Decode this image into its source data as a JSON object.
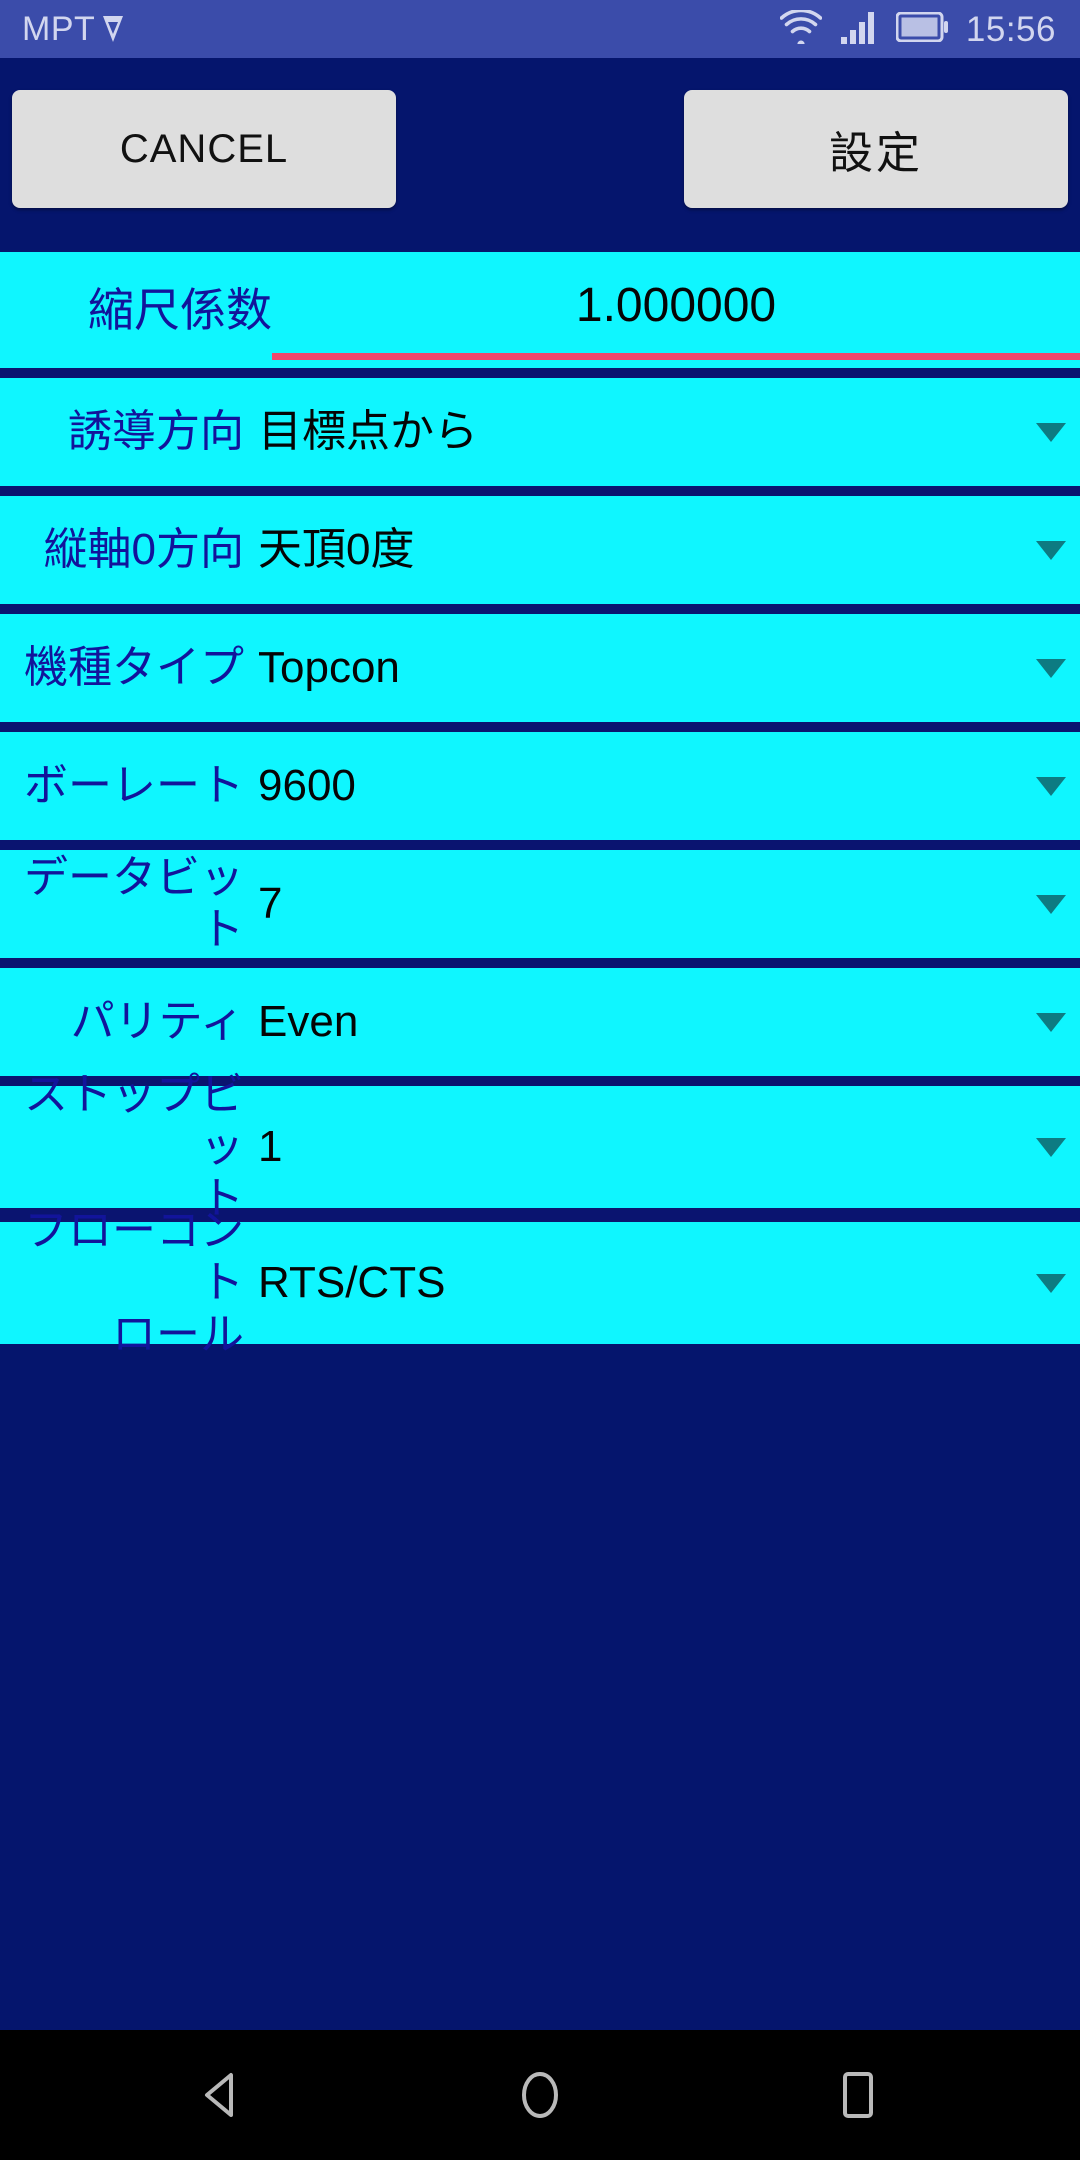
{
  "status_bar": {
    "carrier": "MPT",
    "carrier_logo_icon": "play-badge-icon",
    "wifi_icon": "wifi-icon",
    "signal_icon": "cellular-signal-icon",
    "battery_icon": "battery-full-icon",
    "time": "15:56",
    "background_color": "#3b4caa",
    "foreground_color": "#d2d6ef"
  },
  "toolbar": {
    "cancel_label": "CANCEL",
    "confirm_label": "設定",
    "button_background": "#dedede",
    "button_text_color": "#111111"
  },
  "theme": {
    "app_background": "#05156d",
    "row_background": "#0ff6ff",
    "row_divider": "#0a1470",
    "label_color": "#12149b",
    "value_color": "#050505",
    "underline_color": "#f0486b",
    "caret_color": "#0d7b82"
  },
  "settings": {
    "scale_factor": {
      "label": "縮尺係数",
      "value": "1.000000",
      "type": "text-field"
    },
    "rows": [
      {
        "label": "誘導方向",
        "value": "目標点から",
        "type": "dropdown",
        "caret_icon": "chevron-down-icon"
      },
      {
        "label": "縦軸0方向",
        "value": "天頂0度",
        "type": "dropdown",
        "caret_icon": "chevron-down-icon"
      },
      {
        "label": "機種タイプ",
        "value": "Topcon",
        "type": "dropdown",
        "caret_icon": "chevron-down-icon"
      },
      {
        "label": "ボーレート",
        "value": "9600",
        "type": "dropdown",
        "caret_icon": "chevron-down-icon"
      },
      {
        "label": "データビット",
        "value": "7",
        "type": "dropdown",
        "caret_icon": "chevron-down-icon"
      },
      {
        "label": "パリティ",
        "value": "Even",
        "type": "dropdown",
        "caret_icon": "chevron-down-icon"
      },
      {
        "label": "ストップビッ\nト",
        "value": "1",
        "type": "dropdown",
        "caret_icon": "chevron-down-icon"
      },
      {
        "label": "フローコント\nロール",
        "value": "RTS/CTS",
        "type": "dropdown",
        "caret_icon": "chevron-down-icon"
      }
    ]
  },
  "navbar": {
    "back_icon": "back-triangle-icon",
    "home_icon": "home-circle-icon",
    "recents_icon": "recents-square-icon",
    "background_color": "#000000"
  }
}
